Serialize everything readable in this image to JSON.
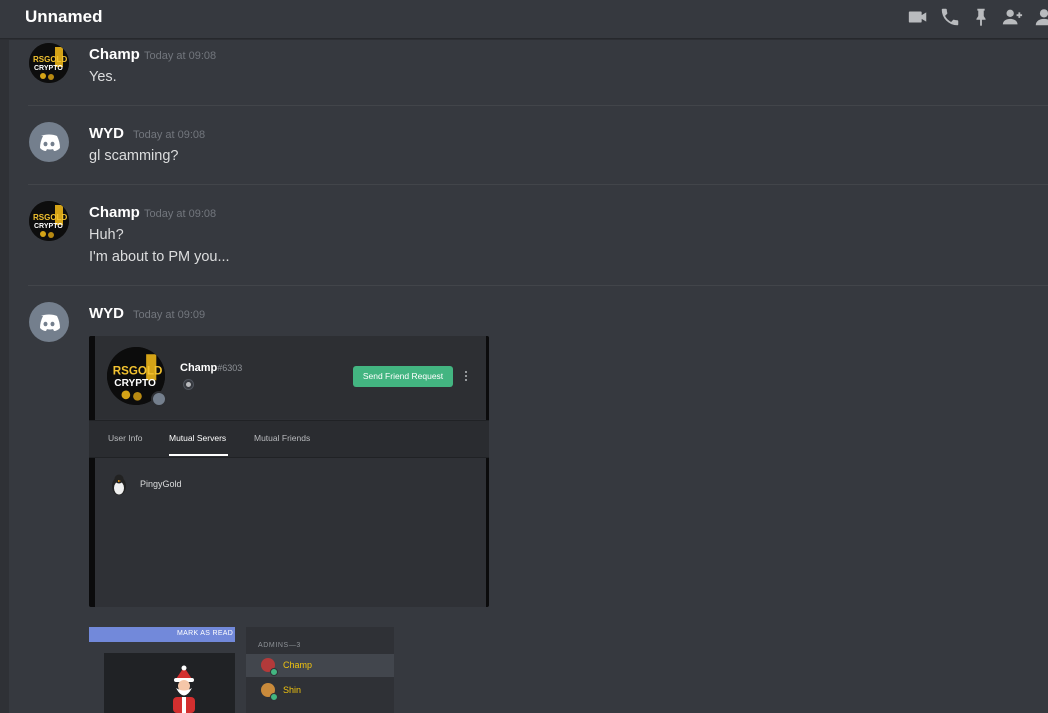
{
  "header": {
    "title": "Unnamed",
    "icons": [
      "video-call-icon",
      "voice-call-icon",
      "pin-icon",
      "add-friend-icon",
      "member-list-icon"
    ]
  },
  "messages": [
    {
      "author": "Champ",
      "timestamp": "Today at 09:08",
      "avatar": "rsgold-crypto-avatar",
      "lines": [
        "Yes."
      ]
    },
    {
      "author": "WYD",
      "timestamp": "Today at 09:08",
      "avatar": "discord-default-avatar",
      "lines": [
        "gl scamming?"
      ]
    },
    {
      "author": "Champ",
      "timestamp": "Today at 09:08",
      "avatar": "rsgold-crypto-avatar",
      "lines": [
        "Huh?",
        "I'm about to PM you..."
      ]
    },
    {
      "author": "WYD",
      "timestamp": "Today at 09:09",
      "avatar": "discord-default-avatar",
      "lines": []
    }
  ],
  "profile_embed": {
    "name": "Champ",
    "discriminator": "#6303",
    "friend_button": "Send Friend Request",
    "tabs": [
      "User Info",
      "Mutual Servers",
      "Mutual Friends"
    ],
    "active_tab": "Mutual Servers",
    "servers": [
      "PingyGold"
    ]
  },
  "members_embed": {
    "mark_as_read": "MARK AS READ",
    "section": "ADMINS—3",
    "members": [
      "Champ",
      "Shin"
    ]
  },
  "colors": {
    "background": "#36393f",
    "accent": "#7289da",
    "green": "#43b581",
    "admin_name": "#f1c40f"
  }
}
